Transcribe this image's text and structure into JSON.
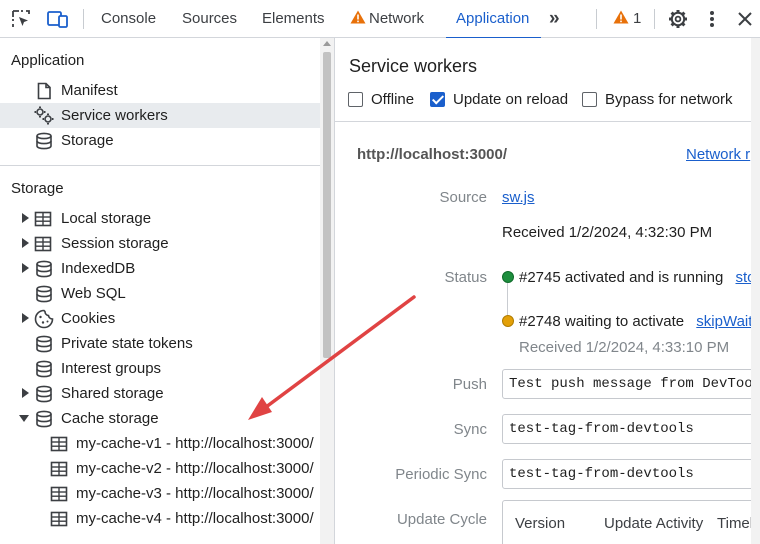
{
  "toolbar": {
    "tabs": [
      {
        "label": "Console"
      },
      {
        "label": "Sources"
      },
      {
        "label": "Elements"
      },
      {
        "label": "Network"
      },
      {
        "label": "Application"
      }
    ],
    "more_glyph": "»",
    "warning_count": "1",
    "icons": [
      "inspect-icon",
      "device-toggle-icon",
      "warning-icon",
      "gear-icon",
      "kebab-menu-icon",
      "close-icon"
    ],
    "accent_color": "#1a5fcc",
    "warning_color": "#e8710a"
  },
  "sidebar": {
    "application": {
      "title": "Application",
      "items": [
        {
          "label": "Manifest",
          "icon": "document-icon"
        },
        {
          "label": "Service workers",
          "icon": "gears-icon"
        },
        {
          "label": "Storage",
          "icon": "database-icon"
        }
      ]
    },
    "storage": {
      "title": "Storage",
      "items": [
        {
          "label": "Local storage",
          "icon": "table-icon"
        },
        {
          "label": "Session storage",
          "icon": "table-icon"
        },
        {
          "label": "IndexedDB",
          "icon": "database-icon"
        },
        {
          "label": "Web SQL",
          "icon": "database-icon"
        },
        {
          "label": "Cookies",
          "icon": "cookie-icon"
        },
        {
          "label": "Private state tokens",
          "icon": "database-icon"
        },
        {
          "label": "Interest groups",
          "icon": "database-icon"
        },
        {
          "label": "Shared storage",
          "icon": "database-icon"
        },
        {
          "label": "Cache storage",
          "icon": "database-icon"
        }
      ],
      "cache_entries": [
        {
          "label": "my-cache-v1 - http://localhost:3000/"
        },
        {
          "label": "my-cache-v2 - http://localhost:3000/"
        },
        {
          "label": "my-cache-v3 - http://localhost:3000/"
        },
        {
          "label": "my-cache-v4 - http://localhost:3000/"
        }
      ]
    }
  },
  "main": {
    "title": "Service workers",
    "options": {
      "offline": {
        "label": "Offline",
        "checked": false
      },
      "update_on_reload": {
        "label": "Update on reload",
        "checked": true
      },
      "bypass_for_network": {
        "label": "Bypass for network",
        "checked": false
      }
    },
    "origin": "http://localhost:3000/",
    "network_requests_link": "Network r",
    "source_label": "Source",
    "source_value": "sw.js",
    "received": "Received 1/2/2024, 4:32:30 PM",
    "status_label": "Status",
    "status_active": "#2745 activated and is running",
    "status_active_action": "sto",
    "status_active_color": "#1e8e3e",
    "status_waiting": "#2748 waiting to activate",
    "status_waiting_action": "skipWait",
    "status_waiting_color": "#e3a008",
    "status_waiting_received": "Received 1/2/2024, 4:33:10 PM",
    "push_label": "Push",
    "push_value": "Test push message from DevTool",
    "sync_label": "Sync",
    "sync_value": "test-tag-from-devtools",
    "periodic_sync_label": "Periodic Sync",
    "periodic_sync_value": "test-tag-from-devtools",
    "update_cycle_label": "Update Cycle",
    "update_cycle_columns": [
      "Version",
      "Update Activity",
      "Timel"
    ]
  },
  "annotation": {
    "color": "#e04343"
  }
}
